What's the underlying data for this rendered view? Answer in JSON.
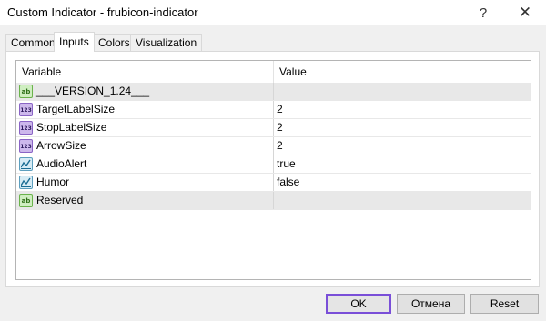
{
  "window": {
    "title": "Custom Indicator - frubicon-indicator",
    "help_glyph": "?",
    "close_glyph": "✕"
  },
  "tabs": [
    {
      "label": "Common",
      "active": false
    },
    {
      "label": "Inputs",
      "active": true
    },
    {
      "label": "Colors",
      "active": false
    },
    {
      "label": "Visualization",
      "active": false
    }
  ],
  "table": {
    "headers": {
      "variable": "Variable",
      "value": "Value"
    },
    "rows": [
      {
        "icon": "ab-string-icon",
        "variable": "___VERSION_1.24___",
        "value": ""
      },
      {
        "icon": "numeric-123-icon",
        "variable": "TargetLabelSize",
        "value": "2"
      },
      {
        "icon": "numeric-123-icon",
        "variable": "StopLabelSize",
        "value": "2"
      },
      {
        "icon": "numeric-123-icon",
        "variable": "ArrowSize",
        "value": "2"
      },
      {
        "icon": "chart-bool-icon",
        "variable": "AudioAlert",
        "value": "true"
      },
      {
        "icon": "chart-bool-icon",
        "variable": "Humor",
        "value": "false"
      },
      {
        "icon": "ab-string-icon",
        "variable": "Reserved",
        "value": ""
      }
    ]
  },
  "buttons": {
    "ok": "OK",
    "cancel": "Отмена",
    "reset": "Reset"
  },
  "icon_text": {
    "ab": "ab",
    "num": "123"
  },
  "colors": {
    "ok_border": "#7a4fd8",
    "row_shade": "#e8e8e8",
    "string_icon": "#cfeec1",
    "numeric_icon": "#cdb8ec",
    "bool_icon": "#d7ecf5"
  }
}
